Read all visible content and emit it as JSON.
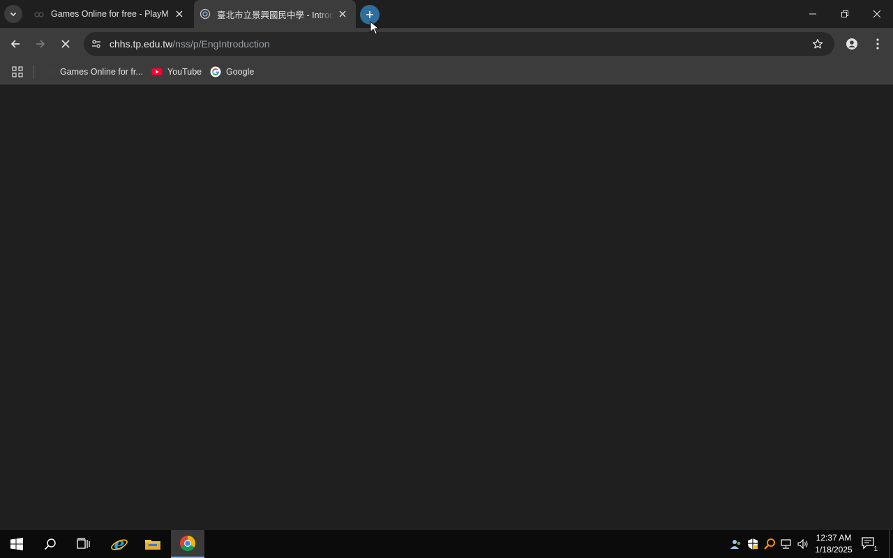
{
  "browser": {
    "tabs": [
      {
        "title": "Games Online for free - PlayMini",
        "active": false
      },
      {
        "title": "臺北市立景興國民中學 - Introduction",
        "active": true
      }
    ],
    "address": {
      "host": "chhs.tp.edu.tw",
      "path": "/nss/p/EngIntroduction"
    },
    "bookmarks": [
      {
        "label": "Games Online for fr...",
        "icon": "playmini-icon"
      },
      {
        "label": "YouTube",
        "icon": "youtube-icon"
      },
      {
        "label": "Google",
        "icon": "google-icon"
      }
    ],
    "loading": true
  },
  "taskbar": {
    "time": "12:37 AM",
    "date": "1/18/2025",
    "notification_count": "1"
  },
  "colors": {
    "frame": "#1f1f1f",
    "toolbar": "#3c3c3c",
    "newtab_accent": "#2f6d9c",
    "taskbar": "#0b0b0b"
  }
}
